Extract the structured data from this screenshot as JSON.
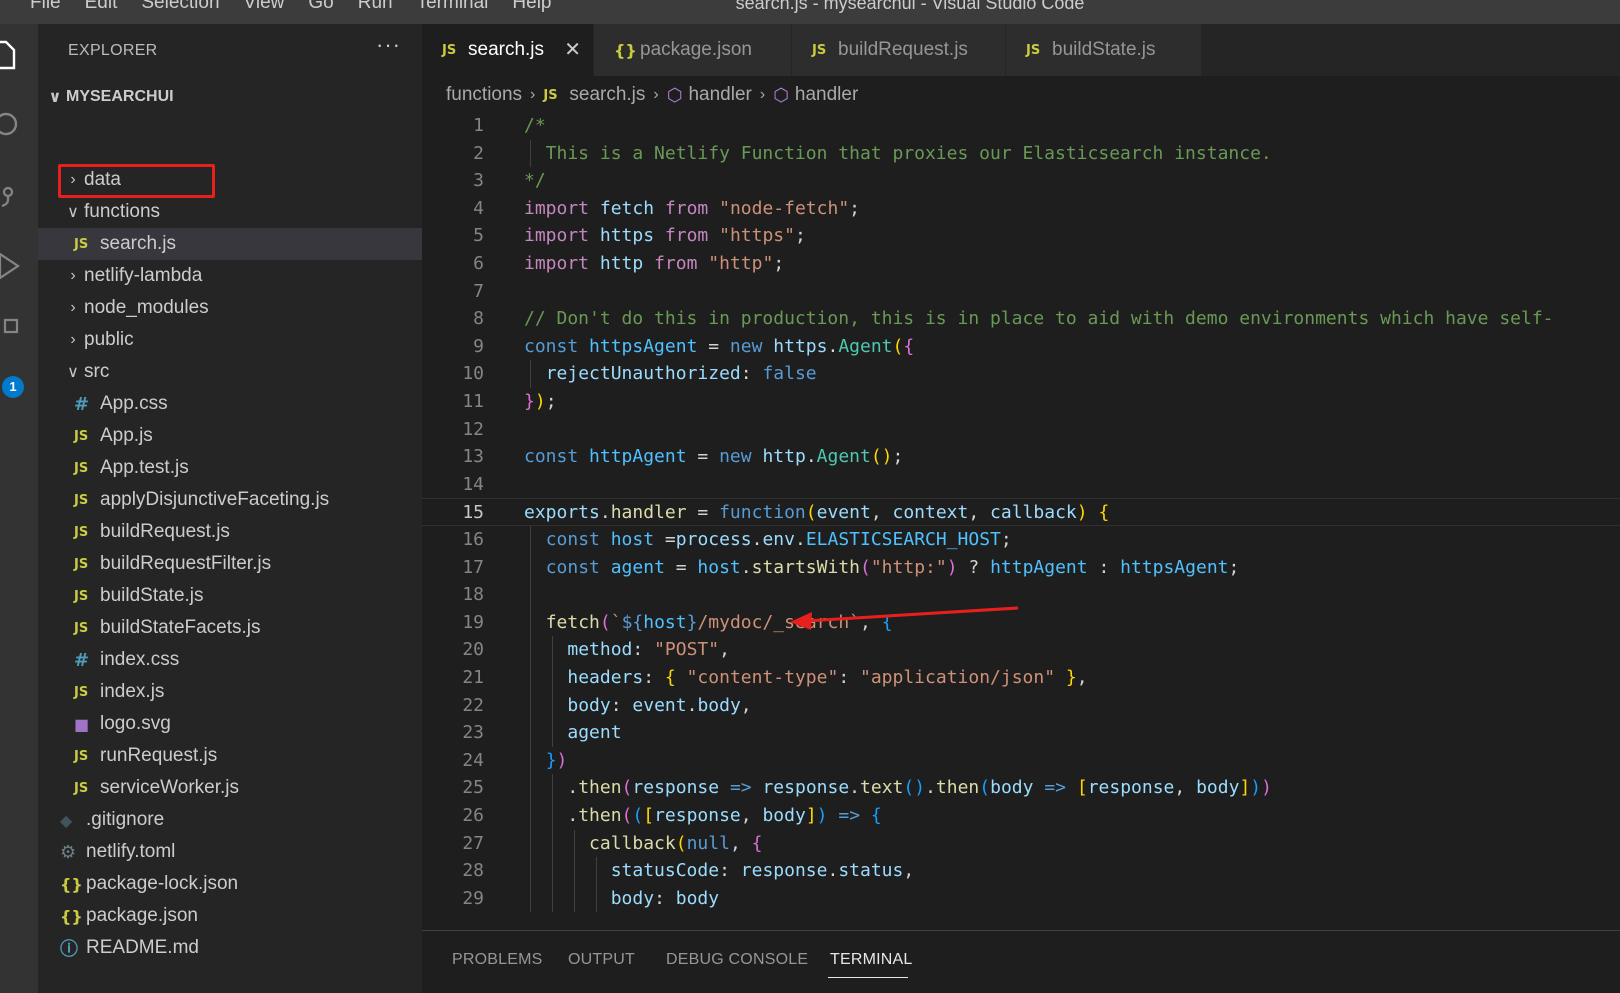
{
  "menubar": {
    "items": [
      "File",
      "Edit",
      "Selection",
      "View",
      "Go",
      "Run",
      "Terminal",
      "Help"
    ],
    "window_title": "search.js - mysearchui - Visual Studio Code"
  },
  "activity_bar": {
    "badge": "1"
  },
  "explorer": {
    "header": "EXPLORER",
    "more": "···",
    "root": "MYSEARCHUI",
    "tree": [
      {
        "label": "data",
        "type": "folder",
        "expanded": false
      },
      {
        "label": "functions",
        "type": "folder",
        "expanded": true
      },
      {
        "label": "search.js",
        "type": "js",
        "selected": true
      },
      {
        "label": "netlify-lambda",
        "type": "folder",
        "expanded": false
      },
      {
        "label": "node_modules",
        "type": "folder",
        "expanded": false
      },
      {
        "label": "public",
        "type": "folder",
        "expanded": false
      },
      {
        "label": "src",
        "type": "folder",
        "expanded": true
      },
      {
        "label": "App.css",
        "type": "css"
      },
      {
        "label": "App.js",
        "type": "js"
      },
      {
        "label": "App.test.js",
        "type": "js"
      },
      {
        "label": "applyDisjunctiveFaceting.js",
        "type": "js"
      },
      {
        "label": "buildRequest.js",
        "type": "js"
      },
      {
        "label": "buildRequestFilter.js",
        "type": "js"
      },
      {
        "label": "buildState.js",
        "type": "js"
      },
      {
        "label": "buildStateFacets.js",
        "type": "js"
      },
      {
        "label": "index.css",
        "type": "css"
      },
      {
        "label": "index.js",
        "type": "js"
      },
      {
        "label": "logo.svg",
        "type": "svg"
      },
      {
        "label": "runRequest.js",
        "type": "js"
      },
      {
        "label": "serviceWorker.js",
        "type": "js"
      },
      {
        "label": ".gitignore",
        "type": "git"
      },
      {
        "label": "netlify.toml",
        "type": "toml"
      },
      {
        "label": "package-lock.json",
        "type": "json"
      },
      {
        "label": "package.json",
        "type": "json"
      },
      {
        "label": "README.md",
        "type": "info"
      }
    ]
  },
  "tabs": [
    {
      "label": "search.js",
      "icon": "js-icon",
      "active": true
    },
    {
      "label": "package.json",
      "icon": "json-icon",
      "active": false
    },
    {
      "label": "buildRequest.js",
      "icon": "js-icon",
      "active": false
    },
    {
      "label": "buildState.js",
      "icon": "js-icon",
      "active": false
    }
  ],
  "breadcrumb": [
    "functions",
    "search.js",
    "handler",
    "handler"
  ],
  "editor": {
    "current_line": 15,
    "lines": [
      {
        "n": 1,
        "t": [
          [
            "/*",
            "com"
          ]
        ]
      },
      {
        "n": 2,
        "t": [
          [
            "  This is a Netlify Function that proxies our Elasticsearch instance.",
            "com"
          ]
        ]
      },
      {
        "n": 3,
        "t": [
          [
            "*/",
            "com"
          ]
        ]
      },
      {
        "n": 4,
        "t": [
          [
            "import",
            "ctl"
          ],
          [
            " ",
            "op"
          ],
          [
            "fetch",
            "var"
          ],
          [
            " ",
            "op"
          ],
          [
            "from",
            "ctl"
          ],
          [
            " ",
            "op"
          ],
          [
            "\"node-fetch\"",
            "str"
          ],
          [
            ";",
            "op"
          ]
        ]
      },
      {
        "n": 5,
        "t": [
          [
            "import",
            "ctl"
          ],
          [
            " ",
            "op"
          ],
          [
            "https",
            "var"
          ],
          [
            " ",
            "op"
          ],
          [
            "from",
            "ctl"
          ],
          [
            " ",
            "op"
          ],
          [
            "\"https\"",
            "str"
          ],
          [
            ";",
            "op"
          ]
        ]
      },
      {
        "n": 6,
        "t": [
          [
            "import",
            "ctl"
          ],
          [
            " ",
            "op"
          ],
          [
            "http",
            "var"
          ],
          [
            " ",
            "op"
          ],
          [
            "from",
            "ctl"
          ],
          [
            " ",
            "op"
          ],
          [
            "\"http\"",
            "str"
          ],
          [
            ";",
            "op"
          ]
        ]
      },
      {
        "n": 7,
        "t": []
      },
      {
        "n": 8,
        "t": [
          [
            "// Don't do this in production, this is in place to aid with demo environments which have self-",
            "com"
          ]
        ]
      },
      {
        "n": 9,
        "t": [
          [
            "const",
            "kw"
          ],
          [
            " ",
            "op"
          ],
          [
            "httpsAgent",
            "const"
          ],
          [
            " = ",
            "op"
          ],
          [
            "new",
            "kw"
          ],
          [
            " ",
            "op"
          ],
          [
            "https",
            "var"
          ],
          [
            ".",
            "op"
          ],
          [
            "Agent",
            "cls"
          ],
          [
            "(",
            "b1"
          ],
          [
            "{",
            "b2"
          ]
        ]
      },
      {
        "n": 10,
        "t": [
          [
            "  ",
            "op"
          ],
          [
            "rejectUnauthorized",
            "var"
          ],
          [
            ": ",
            "op"
          ],
          [
            "false",
            "kw"
          ]
        ]
      },
      {
        "n": 11,
        "t": [
          [
            "}",
            "b2"
          ],
          [
            ")",
            "b1"
          ],
          [
            ";",
            "op"
          ]
        ]
      },
      {
        "n": 12,
        "t": []
      },
      {
        "n": 13,
        "t": [
          [
            "const",
            "kw"
          ],
          [
            " ",
            "op"
          ],
          [
            "httpAgent",
            "const"
          ],
          [
            " = ",
            "op"
          ],
          [
            "new",
            "kw"
          ],
          [
            " ",
            "op"
          ],
          [
            "http",
            "var"
          ],
          [
            ".",
            "op"
          ],
          [
            "Agent",
            "cls"
          ],
          [
            "()",
            "b1"
          ],
          [
            ";",
            "op"
          ]
        ]
      },
      {
        "n": 14,
        "t": []
      },
      {
        "n": 15,
        "t": [
          [
            "exports",
            "var"
          ],
          [
            ".",
            "op"
          ],
          [
            "handler",
            "fn"
          ],
          [
            " = ",
            "op"
          ],
          [
            "function",
            "kw"
          ],
          [
            "(",
            "b1"
          ],
          [
            "event",
            "var"
          ],
          [
            ", ",
            "op"
          ],
          [
            "context",
            "var"
          ],
          [
            ", ",
            "op"
          ],
          [
            "callback",
            "var"
          ],
          [
            ")",
            "b1"
          ],
          [
            " ",
            "op"
          ],
          [
            "{",
            "b1"
          ]
        ]
      },
      {
        "n": 16,
        "t": [
          [
            "  ",
            "op"
          ],
          [
            "const",
            "kw"
          ],
          [
            " ",
            "op"
          ],
          [
            "host",
            "const"
          ],
          [
            " =",
            "op"
          ],
          [
            "process",
            "var"
          ],
          [
            ".",
            "op"
          ],
          [
            "env",
            "var"
          ],
          [
            ".",
            "op"
          ],
          [
            "ELASTICSEARCH_HOST",
            "const"
          ],
          [
            ";",
            "op"
          ]
        ]
      },
      {
        "n": 17,
        "t": [
          [
            "  ",
            "op"
          ],
          [
            "const",
            "kw"
          ],
          [
            " ",
            "op"
          ],
          [
            "agent",
            "const"
          ],
          [
            " = ",
            "op"
          ],
          [
            "host",
            "const"
          ],
          [
            ".",
            "op"
          ],
          [
            "startsWith",
            "fn"
          ],
          [
            "(",
            "b2"
          ],
          [
            "\"http:\"",
            "str"
          ],
          [
            ")",
            "b2"
          ],
          [
            " ? ",
            "op"
          ],
          [
            "httpAgent",
            "const"
          ],
          [
            " : ",
            "op"
          ],
          [
            "httpsAgent",
            "const"
          ],
          [
            ";",
            "op"
          ]
        ]
      },
      {
        "n": 18,
        "t": []
      },
      {
        "n": 19,
        "t": [
          [
            "  ",
            "op"
          ],
          [
            "fetch",
            "fn"
          ],
          [
            "(",
            "b2"
          ],
          [
            "`",
            "str"
          ],
          [
            "${",
            "kw"
          ],
          [
            "host",
            "const"
          ],
          [
            "}",
            "kw"
          ],
          [
            "/mydoc/_search`",
            "str"
          ],
          [
            ", ",
            "op"
          ],
          [
            "{",
            "b3"
          ]
        ]
      },
      {
        "n": 20,
        "t": [
          [
            "    ",
            "op"
          ],
          [
            "method",
            "var"
          ],
          [
            ": ",
            "op"
          ],
          [
            "\"POST\"",
            "str"
          ],
          [
            ",",
            "op"
          ]
        ]
      },
      {
        "n": 21,
        "t": [
          [
            "    ",
            "op"
          ],
          [
            "headers",
            "var"
          ],
          [
            ": ",
            "op"
          ],
          [
            "{",
            "b1"
          ],
          [
            " ",
            "op"
          ],
          [
            "\"content-type\"",
            "str"
          ],
          [
            ": ",
            "op"
          ],
          [
            "\"application/json\"",
            "str"
          ],
          [
            " ",
            "op"
          ],
          [
            "}",
            "b1"
          ],
          [
            ",",
            "op"
          ]
        ]
      },
      {
        "n": 22,
        "t": [
          [
            "    ",
            "op"
          ],
          [
            "body",
            "var"
          ],
          [
            ": ",
            "op"
          ],
          [
            "event",
            "var"
          ],
          [
            ".",
            "op"
          ],
          [
            "body",
            "var"
          ],
          [
            ",",
            "op"
          ]
        ]
      },
      {
        "n": 23,
        "t": [
          [
            "    ",
            "op"
          ],
          [
            "agent",
            "var"
          ]
        ]
      },
      {
        "n": 24,
        "t": [
          [
            "  ",
            "op"
          ],
          [
            "}",
            "b3"
          ],
          [
            ")",
            "b2"
          ]
        ]
      },
      {
        "n": 25,
        "t": [
          [
            "    .",
            "op"
          ],
          [
            "then",
            "fn"
          ],
          [
            "(",
            "b2"
          ],
          [
            "response",
            "var"
          ],
          [
            " ",
            "op"
          ],
          [
            "=>",
            "kw"
          ],
          [
            " ",
            "op"
          ],
          [
            "response",
            "var"
          ],
          [
            ".",
            "op"
          ],
          [
            "text",
            "fn"
          ],
          [
            "()",
            "b3"
          ],
          [
            ".",
            "op"
          ],
          [
            "then",
            "fn"
          ],
          [
            "(",
            "b3"
          ],
          [
            "body",
            "var"
          ],
          [
            " ",
            "op"
          ],
          [
            "=>",
            "kw"
          ],
          [
            " ",
            "op"
          ],
          [
            "[",
            "b1"
          ],
          [
            "response",
            "var"
          ],
          [
            ", ",
            "op"
          ],
          [
            "body",
            "var"
          ],
          [
            "]",
            "b1"
          ],
          [
            ")",
            "b3"
          ],
          [
            ")",
            "b2"
          ]
        ]
      },
      {
        "n": 26,
        "t": [
          [
            "    .",
            "op"
          ],
          [
            "then",
            "fn"
          ],
          [
            "(",
            "b2"
          ],
          [
            "(",
            "b3"
          ],
          [
            "[",
            "b1"
          ],
          [
            "response",
            "var"
          ],
          [
            ", ",
            "op"
          ],
          [
            "body",
            "var"
          ],
          [
            "]",
            "b1"
          ],
          [
            ")",
            "b3"
          ],
          [
            " ",
            "op"
          ],
          [
            "=>",
            "kw"
          ],
          [
            " ",
            "op"
          ],
          [
            "{",
            "b3"
          ]
        ]
      },
      {
        "n": 27,
        "t": [
          [
            "      ",
            "op"
          ],
          [
            "callback",
            "fn"
          ],
          [
            "(",
            "b1"
          ],
          [
            "null",
            "kw"
          ],
          [
            ", ",
            "op"
          ],
          [
            "{",
            "b2"
          ]
        ]
      },
      {
        "n": 28,
        "t": [
          [
            "        ",
            "op"
          ],
          [
            "statusCode",
            "var"
          ],
          [
            ": ",
            "op"
          ],
          [
            "response",
            "var"
          ],
          [
            ".",
            "op"
          ],
          [
            "status",
            "var"
          ],
          [
            ",",
            "op"
          ]
        ]
      },
      {
        "n": 29,
        "t": [
          [
            "        ",
            "op"
          ],
          [
            "body",
            "var"
          ],
          [
            ": ",
            "op"
          ],
          [
            "body",
            "var"
          ]
        ]
      }
    ]
  },
  "panel": {
    "tabs": [
      "PROBLEMS",
      "OUTPUT",
      "DEBUG CONSOLE",
      "TERMINAL"
    ],
    "active": "TERMINAL"
  },
  "colors": {
    "annotation": "#e8201d",
    "accent": "#007acc"
  }
}
